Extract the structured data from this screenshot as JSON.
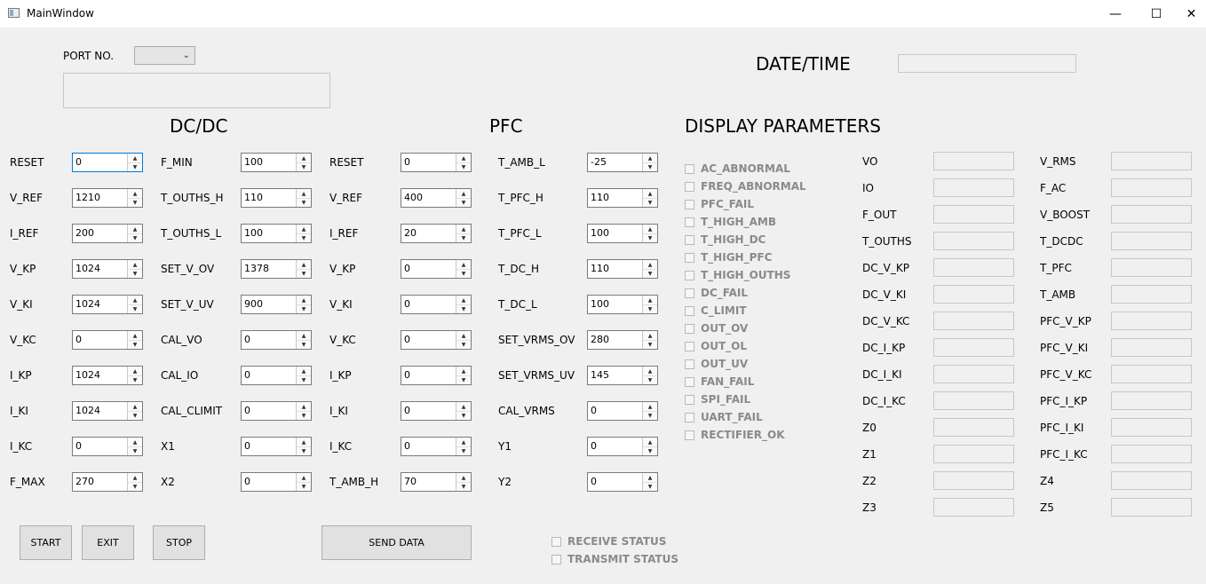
{
  "window": {
    "title": "MainWindow",
    "minimize": "—",
    "maximize": "☐",
    "close": "✕"
  },
  "port": {
    "label": "PORT NO.",
    "value": "",
    "chevron": "⌄"
  },
  "datetime": {
    "label": "DATE/TIME",
    "value": ""
  },
  "sections": {
    "dcdc": "DC/DC",
    "pfc": "PFC",
    "display": "DISPLAY PARAMETERS"
  },
  "dcdc_col1": [
    {
      "label": "RESET",
      "value": "0"
    },
    {
      "label": "V_REF",
      "value": "1210"
    },
    {
      "label": "I_REF",
      "value": "200"
    },
    {
      "label": "V_KP",
      "value": "1024"
    },
    {
      "label": "V_KI",
      "value": "1024"
    },
    {
      "label": "V_KC",
      "value": "0"
    },
    {
      "label": "I_KP",
      "value": "1024"
    },
    {
      "label": "I_KI",
      "value": "1024"
    },
    {
      "label": "I_KC",
      "value": "0"
    },
    {
      "label": "F_MAX",
      "value": "270"
    }
  ],
  "dcdc_col2": [
    {
      "label": "F_MIN",
      "value": "100"
    },
    {
      "label": "T_OUTHS_H",
      "value": "110"
    },
    {
      "label": "T_OUTHS_L",
      "value": "100"
    },
    {
      "label": "SET_V_OV",
      "value": "1378"
    },
    {
      "label": "SET_V_UV",
      "value": "900"
    },
    {
      "label": "CAL_VO",
      "value": "0"
    },
    {
      "label": "CAL_IO",
      "value": "0"
    },
    {
      "label": "CAL_CLIMIT",
      "value": "0"
    },
    {
      "label": "X1",
      "value": "0"
    },
    {
      "label": "X2",
      "value": "0"
    }
  ],
  "pfc_col1": [
    {
      "label": "RESET",
      "value": "0"
    },
    {
      "label": "V_REF",
      "value": "400"
    },
    {
      "label": "I_REF",
      "value": "20"
    },
    {
      "label": "V_KP",
      "value": "0"
    },
    {
      "label": "V_KI",
      "value": "0"
    },
    {
      "label": "V_KC",
      "value": "0"
    },
    {
      "label": "I_KP",
      "value": "0"
    },
    {
      "label": "I_KI",
      "value": "0"
    },
    {
      "label": "I_KC",
      "value": "0"
    },
    {
      "label": "T_AMB_H",
      "value": "70"
    }
  ],
  "pfc_col2": [
    {
      "label": "T_AMB_L",
      "value": "-25"
    },
    {
      "label": "T_PFC_H",
      "value": "110"
    },
    {
      "label": "T_PFC_L",
      "value": "100"
    },
    {
      "label": "T_DC_H",
      "value": "110"
    },
    {
      "label": "T_DC_L",
      "value": "100"
    },
    {
      "label": "SET_VRMS_OV",
      "value": "280"
    },
    {
      "label": "SET_VRMS_UV",
      "value": "145"
    },
    {
      "label": "CAL_VRMS",
      "value": "0"
    },
    {
      "label": "Y1",
      "value": "0"
    },
    {
      "label": "Y2",
      "value": "0"
    }
  ],
  "status_flags": [
    "AC_ABNORMAL",
    "FREQ_ABNORMAL",
    "PFC_FAIL",
    "T_HIGH_AMB",
    "T_HIGH_DC",
    "T_HIGH_PFC",
    "T_HIGH_OUTHS",
    "DC_FAIL",
    "C_LIMIT",
    "OUT_OV",
    "OUT_OL",
    "OUT_UV",
    "FAN_FAIL",
    "SPI_FAIL",
    "UART_FAIL",
    "RECTIFIER_OK"
  ],
  "display_col1": [
    "VO",
    "IO",
    "F_OUT",
    "T_OUTHS",
    "DC_V_KP",
    "DC_V_KI",
    "DC_V_KC",
    "DC_I_KP",
    "DC_I_KI",
    "DC_I_KC",
    "Z0",
    "Z1",
    "Z2",
    "Z3"
  ],
  "display_col2": [
    "V_RMS",
    "F_AC",
    "V_BOOST",
    "T_DCDC",
    "T_PFC",
    "T_AMB",
    "PFC_V_KP",
    "PFC_V_KI",
    "PFC_V_KC",
    "PFC_I_KP",
    "PFC_I_KI",
    "PFC_I_KC",
    "Z4",
    "Z5"
  ],
  "buttons": {
    "start": "START",
    "exit": "EXIT",
    "stop": "STOP",
    "send": "SEND DATA"
  },
  "comm_status": {
    "receive": "RECEIVE STATUS",
    "transmit": "TRANSMIT STATUS"
  },
  "spin_arrows": {
    "up": "▲",
    "down": "▼"
  },
  "colors": {
    "background": "#f0f0f0",
    "focus_border": "#0078d7",
    "disabled_text": "#8a8a8a"
  }
}
